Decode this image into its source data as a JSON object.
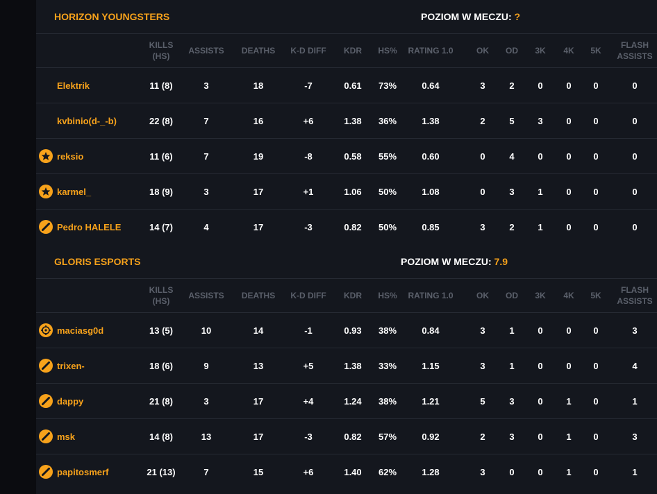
{
  "columns": [
    "KILLS (HS)",
    "ASSISTS",
    "DEATHS",
    "K-D DIFF",
    "KDR",
    "HS%",
    "RATING 1.0",
    "OK",
    "OD",
    "3K",
    "4K",
    "5K",
    "FLASH ASSISTS"
  ],
  "teams": [
    {
      "name": "HORIZON YOUNGSTERS",
      "level_label": "POZIOM W MECZU:",
      "level_value": "?",
      "players": [
        {
          "name": "Elektrik",
          "icon": "none",
          "stats": [
            "11 (8)",
            "3",
            "18",
            "-7",
            "0.61",
            "73%",
            "0.64",
            "3",
            "2",
            "0",
            "0",
            "0",
            "0"
          ]
        },
        {
          "name": "kvbinio(d-_-b)",
          "icon": "none",
          "stats": [
            "22 (8)",
            "7",
            "16",
            "+6",
            "1.38",
            "36%",
            "1.38",
            "2",
            "5",
            "3",
            "0",
            "0",
            "0"
          ]
        },
        {
          "name": "reksio",
          "icon": "star-badge-icon",
          "stats": [
            "11 (6)",
            "7",
            "19",
            "-8",
            "0.58",
            "55%",
            "0.60",
            "0",
            "4",
            "0",
            "0",
            "0",
            "0"
          ]
        },
        {
          "name": "karmel_",
          "icon": "star-badge-icon",
          "stats": [
            "18 (9)",
            "3",
            "17",
            "+1",
            "1.06",
            "50%",
            "1.08",
            "0",
            "3",
            "1",
            "0",
            "0",
            "0"
          ]
        },
        {
          "name": "Pedro HALELE",
          "icon": "rifle-badge-icon",
          "stats": [
            "14 (7)",
            "4",
            "17",
            "-3",
            "0.82",
            "50%",
            "0.85",
            "3",
            "2",
            "1",
            "0",
            "0",
            "0"
          ]
        }
      ]
    },
    {
      "name": "GLORIS ESPORTS",
      "level_label": "POZIOM W MECZU:",
      "level_value": "7.9",
      "players": [
        {
          "name": "maciasg0d",
          "icon": "crosshair-badge-icon",
          "stats": [
            "13 (5)",
            "10",
            "14",
            "-1",
            "0.93",
            "38%",
            "0.84",
            "3",
            "1",
            "0",
            "0",
            "0",
            "3"
          ]
        },
        {
          "name": "trixen-",
          "icon": "rifle-badge-icon",
          "stats": [
            "18 (6)",
            "9",
            "13",
            "+5",
            "1.38",
            "33%",
            "1.15",
            "3",
            "1",
            "0",
            "0",
            "0",
            "4"
          ]
        },
        {
          "name": "dappy",
          "icon": "rifle-badge-icon",
          "stats": [
            "21 (8)",
            "3",
            "17",
            "+4",
            "1.24",
            "38%",
            "1.21",
            "5",
            "3",
            "0",
            "1",
            "0",
            "1"
          ]
        },
        {
          "name": "msk",
          "icon": "rifle-badge-icon",
          "stats": [
            "14 (8)",
            "13",
            "17",
            "-3",
            "0.82",
            "57%",
            "0.92",
            "2",
            "3",
            "0",
            "1",
            "0",
            "3"
          ]
        },
        {
          "name": "papitosmerf",
          "icon": "rifle-badge-icon",
          "stats": [
            "21 (13)",
            "7",
            "15",
            "+6",
            "1.40",
            "62%",
            "1.28",
            "3",
            "0",
            "0",
            "1",
            "0",
            "1"
          ]
        }
      ]
    }
  ],
  "colors": {
    "accent": "#f7a21b",
    "panel": "#14171e",
    "header_text": "#5b606b",
    "row_border": "#262a33"
  }
}
